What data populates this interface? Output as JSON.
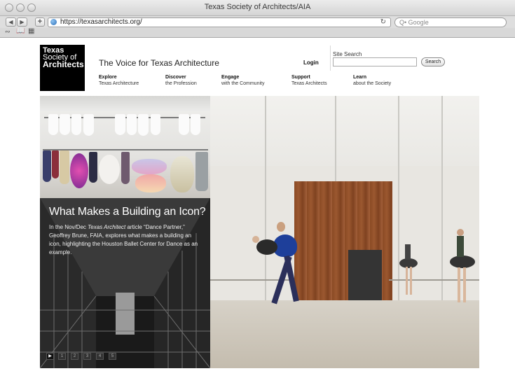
{
  "window": {
    "title": "Texas Society of Architects/AIA",
    "url": "https://texasarchitects.org/",
    "search_placeholder": "Google",
    "search_prefix": "Q•"
  },
  "toolbar_icons": [
    "back-icon",
    "forward-icon",
    "add-icon",
    "reload-icon"
  ],
  "logo": {
    "line1": "Texas",
    "line2": "Society of",
    "line3": "Architects"
  },
  "header": {
    "tagline": "The Voice for Texas Architecture",
    "login": "Login",
    "site_search_label": "Site Search",
    "search_button": "Search"
  },
  "nav": [
    {
      "title": "Explore",
      "sub": "Texas Architecture"
    },
    {
      "title": "Discover",
      "sub": "the Profession"
    },
    {
      "title": "Engage",
      "sub": "with the Community"
    },
    {
      "title": "Support",
      "sub": "Texas Architects"
    },
    {
      "title": "Learn",
      "sub": "about the Society"
    }
  ],
  "feature": {
    "title": "What Makes a Building an Icon?",
    "body_1": "In the Nov/Dec ",
    "body_italic": "Texas Architect",
    "body_2": " article “Dance Partner,” Geoffrey Brune, FAIA, explores what makes a building an icon, highlighting the Houston Ballet Center for Dance as an example."
  },
  "pager": [
    "▶",
    "1",
    "2",
    "3",
    "4",
    "5"
  ],
  "colors": {
    "logo_bg": "#000000",
    "caption_bg": "#131313",
    "wood": "#8a4a24"
  }
}
